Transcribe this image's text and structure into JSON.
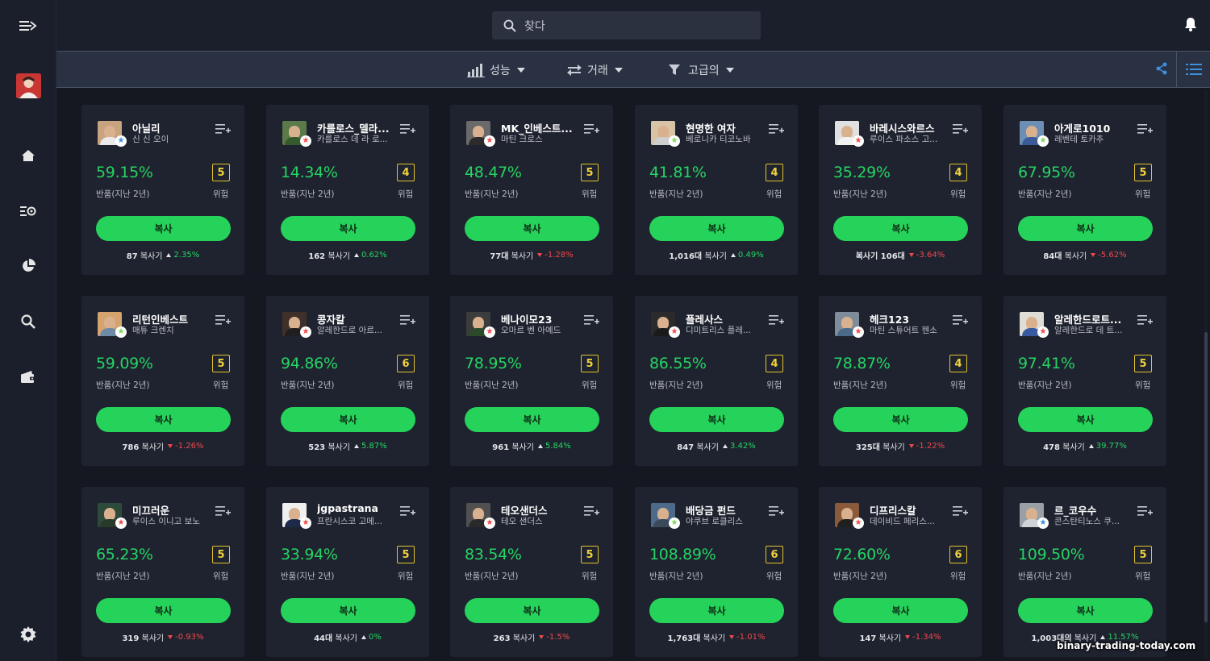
{
  "header": {
    "search_placeholder": "찾다"
  },
  "filters": [
    {
      "label": "성능",
      "icon": "bar-chart-icon"
    },
    {
      "label": "거래",
      "icon": "exchange-icon"
    },
    {
      "label": "고급의",
      "icon": "filter-icon"
    }
  ],
  "sidebar": {
    "items": [
      "collapse-icon",
      "home-icon",
      "watchlist-icon",
      "portfolio-pie-icon",
      "search-icon",
      "wallet-icon",
      "settings-icon"
    ]
  },
  "card_labels": {
    "return": "반품(지난 2년)",
    "risk": "위험",
    "copy": "복사"
  },
  "traders": [
    {
      "name": "아닐리",
      "sub": "신 신 오이",
      "return": "59.15%",
      "risk": "5",
      "copiers_prefix": "87",
      "copiers_text": "복사기",
      "change": "2.35%",
      "dir": "up",
      "badge": "blue"
    },
    {
      "name": "카를로스_델라...",
      "sub": "카를로스 데 라 로...",
      "return": "14.34%",
      "risk": "4",
      "copiers_prefix": "162",
      "copiers_text": "복사기",
      "change": "0.62%",
      "dir": "up",
      "badge": "red"
    },
    {
      "name": "MK_인베스트...",
      "sub": "마틴 크로스",
      "return": "48.47%",
      "risk": "5",
      "copiers_prefix": "77대",
      "copiers_text": "복사기",
      "change": "-1.28%",
      "dir": "down",
      "badge": "red"
    },
    {
      "name": "현명한 여자",
      "sub": "베로니카 티코노바",
      "return": "41.81%",
      "risk": "4",
      "copiers_prefix": "1,016대",
      "copiers_text": "복사기",
      "change": "0.49%",
      "dir": "up",
      "badge": "green"
    },
    {
      "name": "바레시스와르스",
      "sub": "루이스 파소스 고...",
      "return": "35.29%",
      "risk": "4",
      "copiers_prefix": "복사기 106대",
      "copiers_text": "",
      "change": "-3.64%",
      "dir": "down",
      "badge": "red"
    },
    {
      "name": "아게로1010",
      "sub": "레벤테 토카추",
      "return": "67.95%",
      "risk": "5",
      "copiers_prefix": "84대",
      "copiers_text": "복사기",
      "change": "-5.62%",
      "dir": "down",
      "badge": "green"
    },
    {
      "name": "리턴인베스트",
      "sub": "매튜 크렌치",
      "return": "59.09%",
      "risk": "5",
      "copiers_prefix": "786",
      "copiers_text": "복사기",
      "change": "-1.26%",
      "dir": "down",
      "badge": "green"
    },
    {
      "name": "콩자칼",
      "sub": "알레한드로 아르...",
      "return": "94.86%",
      "risk": "6",
      "copiers_prefix": "523",
      "copiers_text": "복사기",
      "change": "5.87%",
      "dir": "up",
      "badge": "red"
    },
    {
      "name": "베나이모23",
      "sub": "오마르 벤 아예드",
      "return": "78.95%",
      "risk": "5",
      "copiers_prefix": "961",
      "copiers_text": "복사기",
      "change": "5.84%",
      "dir": "up",
      "badge": "red"
    },
    {
      "name": "플레사스",
      "sub": "디미트리스 플레...",
      "return": "86.55%",
      "risk": "4",
      "copiers_prefix": "847",
      "copiers_text": "복사기",
      "change": "3.42%",
      "dir": "up",
      "badge": "red"
    },
    {
      "name": "헤크123",
      "sub": "마틴 스튜어트 헨소",
      "return": "78.87%",
      "risk": "4",
      "copiers_prefix": "325대",
      "copiers_text": "복사기",
      "change": "-1.22%",
      "dir": "down",
      "badge": "red"
    },
    {
      "name": "알레한드로트...",
      "sub": "알레한드로 데 트...",
      "return": "97.41%",
      "risk": "5",
      "copiers_prefix": "478",
      "copiers_text": "복사기",
      "change": "39.77%",
      "dir": "up",
      "badge": "red"
    },
    {
      "name": "미끄러운",
      "sub": "루이스 이니고 보노",
      "return": "65.23%",
      "risk": "5",
      "copiers_prefix": "319",
      "copiers_text": "복사기",
      "change": "-0.93%",
      "dir": "down",
      "badge": "red"
    },
    {
      "name": "jgpastrana",
      "sub": "프란시스코 고메...",
      "return": "33.94%",
      "risk": "5",
      "copiers_prefix": "44대",
      "copiers_text": "복사기",
      "change": "0%",
      "dir": "up",
      "badge": "red"
    },
    {
      "name": "테오샌더스",
      "sub": "테오 샌더스",
      "return": "83.54%",
      "risk": "5",
      "copiers_prefix": "263",
      "copiers_text": "복사기",
      "change": "-1.5%",
      "dir": "down",
      "badge": "red"
    },
    {
      "name": "배당금 펀드",
      "sub": "야쿠브 로클리스",
      "return": "108.89%",
      "risk": "6",
      "copiers_prefix": "1,763대",
      "copiers_text": "복사기",
      "change": "-1.01%",
      "dir": "down",
      "badge": "green"
    },
    {
      "name": "디프리스칼",
      "sub": "데이비드 페리스...",
      "return": "72.60%",
      "risk": "6",
      "copiers_prefix": "147",
      "copiers_text": "복사기",
      "change": "-1.34%",
      "dir": "down",
      "badge": "red"
    },
    {
      "name": "르_코우수",
      "sub": "콘스탄티노스 쿠...",
      "return": "109.50%",
      "risk": "5",
      "copiers_prefix": "1,003대의",
      "copiers_text": "복사기",
      "change": "11.57%",
      "dir": "up",
      "badge": "blue"
    }
  ],
  "watermark": "binary-trading-today.com",
  "colors": {
    "positive": "#25d464",
    "negative": "#f0484b",
    "risk_border": "#e3c330",
    "copy_button": "#26d35a"
  }
}
